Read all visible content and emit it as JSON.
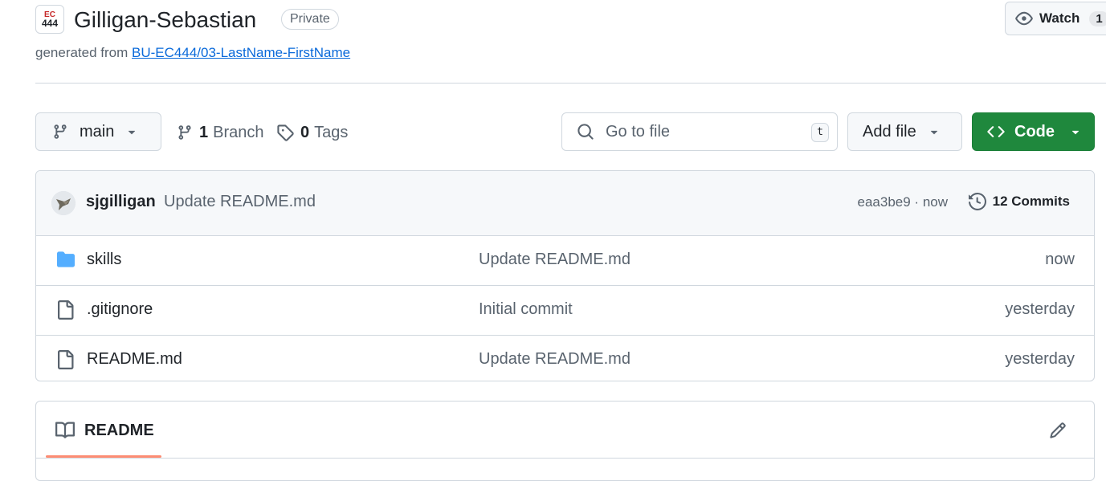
{
  "repo": {
    "logo_line1": "EC",
    "logo_line2": "444",
    "name": "Gilligan-Sebastian",
    "visibility": "Private",
    "generated_from_prefix": "generated from",
    "template_link": "BU-EC444/03-LastName-FirstName"
  },
  "watch": {
    "label": "Watch",
    "count": "1"
  },
  "toolbar": {
    "branch_name": "main",
    "branch_count": "1",
    "branch_label": "Branch",
    "tag_count": "0",
    "tag_label": "Tags",
    "search_placeholder": "Go to file",
    "search_shortcut": "t",
    "add_file_label": "Add file",
    "code_label": "Code"
  },
  "latest_commit": {
    "author": "sjgilligan",
    "message": "Update README.md",
    "hash": "eaa3be9",
    "time": "now",
    "separator": " · ",
    "commits_label": "12 Commits"
  },
  "files": [
    {
      "name": "skills",
      "type": "folder",
      "message": "Update README.md",
      "time": "now"
    },
    {
      "name": ".gitignore",
      "type": "file",
      "message": "Initial commit",
      "time": "yesterday"
    },
    {
      "name": "README.md",
      "type": "file",
      "message": "Update README.md",
      "time": "yesterday"
    }
  ],
  "readme": {
    "tab_label": "README"
  },
  "colors": {
    "primary_button": "#1f883d",
    "link": "#0969da",
    "folder": "#54aeff",
    "tab_underline": "#fd8c73"
  },
  "icons": [
    "eye-icon",
    "branch-icon",
    "tag-icon",
    "search-icon",
    "code-icon",
    "history-icon",
    "folder-icon",
    "file-icon",
    "book-icon",
    "pencil-icon",
    "caret-down-icon"
  ]
}
